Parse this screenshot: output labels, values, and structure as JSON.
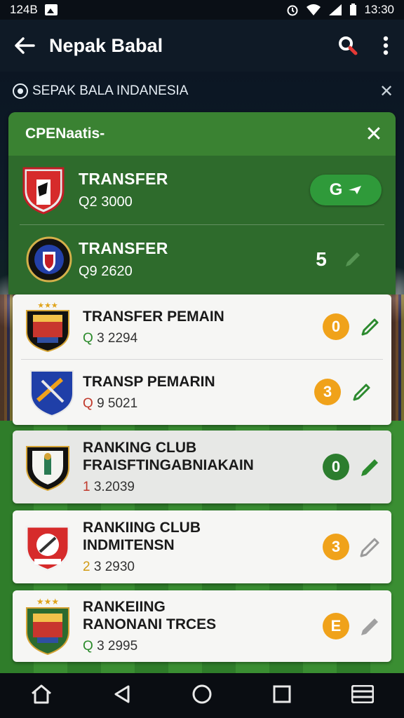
{
  "status": {
    "left_text": "124B",
    "time": "13:30"
  },
  "appbar": {
    "title": "Nepak Babal"
  },
  "chip": {
    "label": "SEPAK BALA INDANESIA"
  },
  "panel": {
    "title": "CPENaatis-",
    "rows": [
      {
        "name": "TRANSFER",
        "value": "Q2 3000",
        "action_label": "G"
      },
      {
        "name": "TRANSFER",
        "value": "Q9 2620",
        "count": "5"
      }
    ]
  },
  "card1": [
    {
      "name": "TRANSFER PEMAIN",
      "lead": "Q",
      "value": "3 2294",
      "badge": "0"
    },
    {
      "name": "TRANSP PEMARIN",
      "lead": "Q",
      "value": "9 5021",
      "badge": "3"
    }
  ],
  "card2": {
    "name1": "RANKING CLUB",
    "name2": "FRAISFTINGABNIAKAIN",
    "lead": "1",
    "value": "3.2039",
    "badge": "0"
  },
  "card3": {
    "name1": "RANKIING CLUB",
    "name2": "INDMITENSN",
    "lead": "2",
    "value": "3 2930",
    "badge": "3"
  },
  "card4": {
    "name1": "RANKEIING",
    "name2": "RANONANI TRCES",
    "lead": "Q",
    "value": "3 2995",
    "badge": "E"
  },
  "colors": {
    "accent_green": "#2f9a3a",
    "badge_orange": "#f0a21a",
    "badge_green": "#2c7d2e",
    "panel_green": "#2e6b2c"
  },
  "icons": [
    "back-arrow-icon",
    "search-icon",
    "more-vert-icon",
    "soccer-ball-icon",
    "close-icon",
    "edit-pencil-icon",
    "home-icon",
    "nav-back-icon",
    "nav-home-icon",
    "recents-icon",
    "menu-icon"
  ]
}
